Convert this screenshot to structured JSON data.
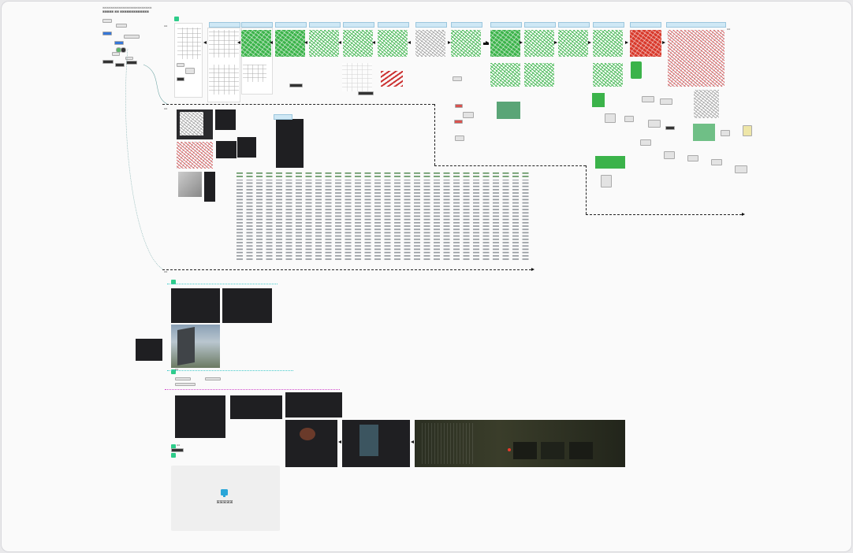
{
  "board": {
    "header_lines": [
      "ꕤꕤꕤꕤꕤꕤꕤꕤꕤꕤꕤꕤꕤꕤꕤꕤꕤꕤꕤꕤꕤꕤꕤꕤꕤ",
      "ꕤꕤꕤꕤꕤ ꕤꕤ ꕤꕤꕤꕤꕤꕤꕤꕤꕤꕤꕤꕤꕤ"
    ],
    "section_labels": [
      "ꕤꕤ",
      "ꕤꕤ",
      "ꕤꕤ",
      "ꕤꕤ",
      "ꕤꕤ"
    ],
    "pipeline_panels": [
      {
        "label": "ꕤꕤꕤꕤꕤ",
        "style": "line"
      },
      {
        "label": "ꕤꕤꕤꕤꕤ",
        "style": "gray"
      },
      {
        "label": "ꕤꕤꕤꕤꕤ",
        "style": "green"
      },
      {
        "label": "ꕤꕤꕤꕤꕤ",
        "style": "green"
      },
      {
        "label": "ꕤꕤꕤꕤꕤ",
        "style": "lightgreen"
      },
      {
        "label": "ꕤꕤꕤꕤꕤ",
        "style": "lightgreen"
      },
      {
        "label": "ꕤꕤꕤꕤꕤ",
        "style": "gray"
      },
      {
        "label": "ꕤꕤꕤꕤꕤ",
        "style": "lightgreen"
      },
      {
        "label": "ꕤꕤꕤꕤꕤ",
        "style": "green"
      },
      {
        "label": "ꕤꕤꕤꕤꕤ",
        "style": "lightgreen"
      },
      {
        "label": "ꕤꕤꕤꕤꕤ",
        "style": "lightgreen"
      },
      {
        "label": "ꕤꕤꕤꕤꕤ",
        "style": "red"
      },
      {
        "label": "ꕤꕤꕤꕤꕤ",
        "style": "pink"
      }
    ],
    "placeholder": {
      "text": "ꕤꕤꕤꕤꕤ"
    },
    "accent_colors": {
      "badge": "#2ecc8a",
      "header": "#cfe8f5",
      "green": "#3bb34a",
      "red": "#d8392b",
      "magenta": "#d24ccc",
      "cyan": "#44cccc"
    },
    "icons": [
      "monitor-icon"
    ]
  }
}
